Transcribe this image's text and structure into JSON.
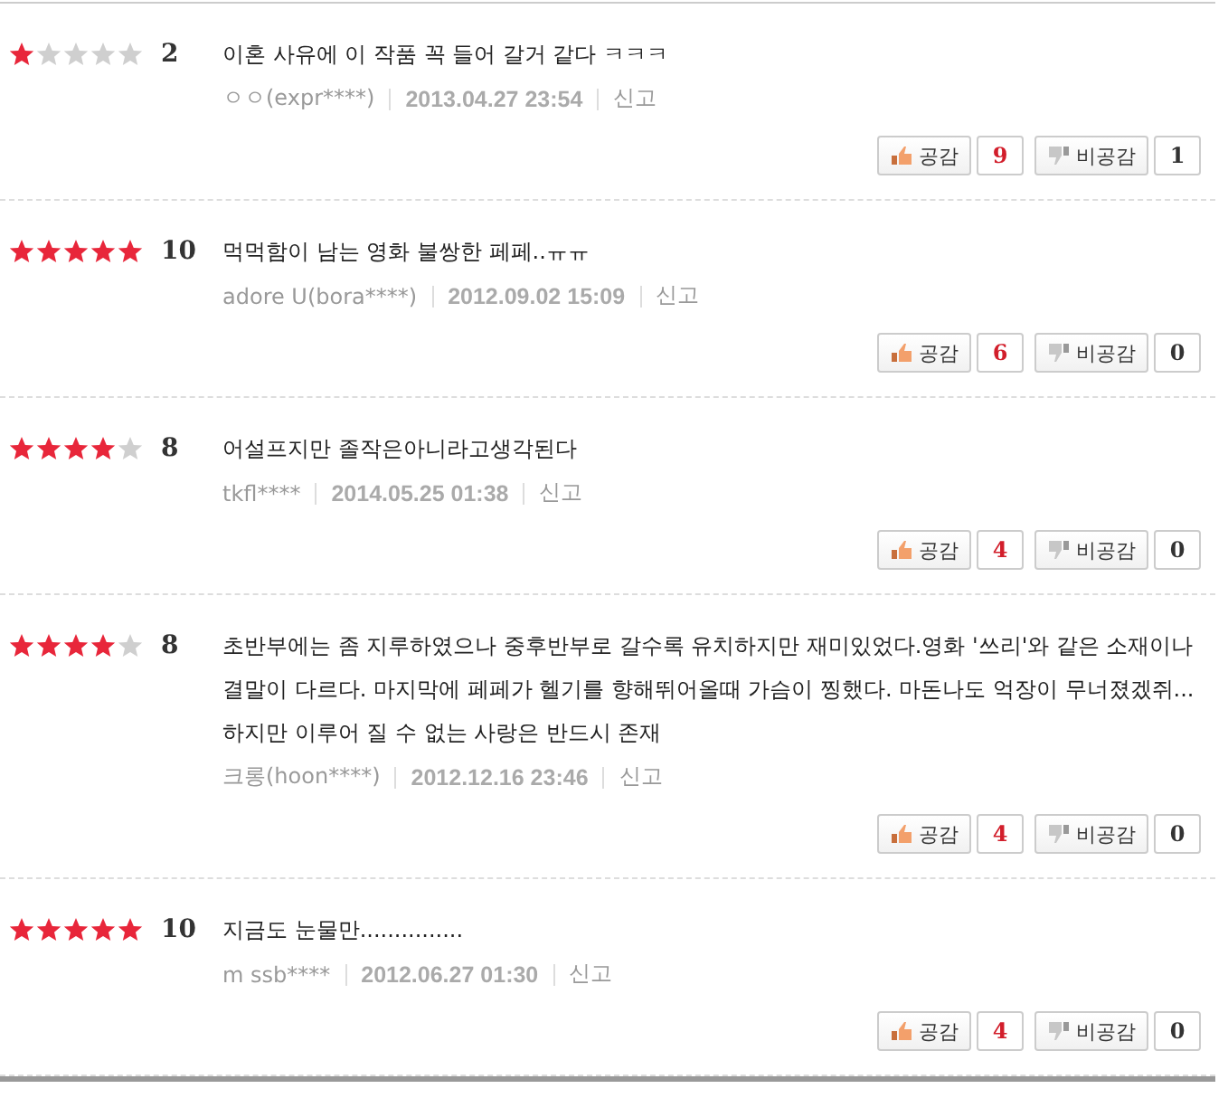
{
  "reviews": [
    {
      "stars": 1,
      "score": "2",
      "text": "이혼 사유에 이 작품 꼭 들어 갈거 같다 ㅋㅋㅋ",
      "author": "ㅇㅇ(expr****)",
      "date": "2013.04.27 23:54",
      "report": "신고",
      "like_label": "공감",
      "likes": "9",
      "dislike_label": "비공감",
      "dislikes": "1"
    },
    {
      "stars": 5,
      "score": "10",
      "text": "먹먹함이 남는 영화 불쌍한 페페..ㅠㅠ",
      "author": "adore U(bora****)",
      "date": "2012.09.02 15:09",
      "report": "신고",
      "like_label": "공감",
      "likes": "6",
      "dislike_label": "비공감",
      "dislikes": "0"
    },
    {
      "stars": 4,
      "score": "8",
      "text": "어설프지만 졸작은아니라고생각된다",
      "author": "tkfl****",
      "date": "2014.05.25 01:38",
      "report": "신고",
      "like_label": "공감",
      "likes": "4",
      "dislike_label": "비공감",
      "dislikes": "0"
    },
    {
      "stars": 4,
      "score": "8",
      "text": "초반부에는 좀 지루하였으나 중후반부로 갈수록 유치하지만 재미있었다.영화 '쓰리'와 같은 소재이나 결말이 다르다. 마지막에 페페가 헬기를 향해뛰어올때 가슴이 찡했다. 마돈나도 억장이 무너졌겠쥐...하지만 이루어 질 수 없는 사랑은 반드시 존재",
      "author": "크롱(hoon****)",
      "date": "2012.12.16 23:46",
      "report": "신고",
      "like_label": "공감",
      "likes": "4",
      "dislike_label": "비공감",
      "dislikes": "0"
    },
    {
      "stars": 5,
      "score": "10",
      "text": "지금도 눈물만...............",
      "author": "m ssb****",
      "date": "2012.06.27 01:30",
      "report": "신고",
      "like_label": "공감",
      "likes": "4",
      "dislike_label": "비공감",
      "dislikes": "0"
    }
  ]
}
